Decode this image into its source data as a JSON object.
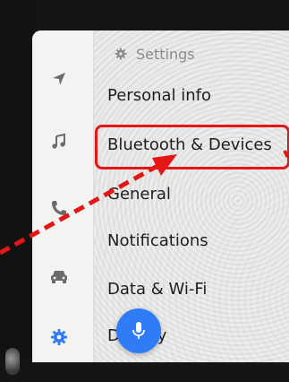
{
  "header": {
    "title": "Settings",
    "icon": "gear-icon"
  },
  "menu": {
    "items": [
      {
        "label": "Personal info"
      },
      {
        "label": "Bluetooth & Devices"
      },
      {
        "label": "General"
      },
      {
        "label": "Notifications"
      },
      {
        "label": "Data & Wi-Fi"
      },
      {
        "label": "Display"
      }
    ]
  },
  "rail": {
    "items": [
      {
        "icon": "navigation-arrow-icon"
      },
      {
        "icon": "music-note-icon"
      },
      {
        "icon": "phone-icon"
      },
      {
        "icon": "car-icon"
      },
      {
        "icon": "gear-icon",
        "active": true
      }
    ]
  },
  "colors": {
    "highlight": "#e41616",
    "accent": "#2f7cf6",
    "active_icon": "#2f7cf6",
    "text": "#1e1e1e",
    "muted": "#8b8b8b"
  },
  "fab": {
    "icon": "microphone-icon"
  }
}
